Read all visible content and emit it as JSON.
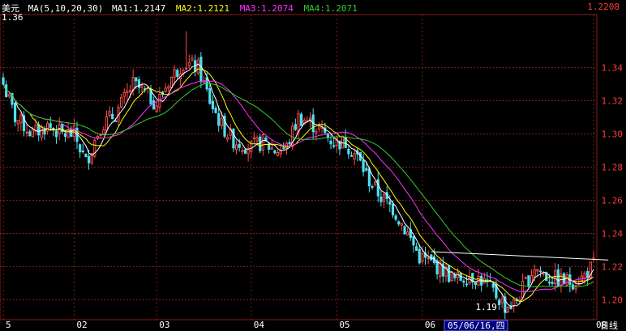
{
  "header": {
    "symbol": "美元",
    "ma_label": "MA(5,10,20,30)",
    "ma1": "MA1:1.2147",
    "ma2": "MA2:1.2121",
    "ma3": "MA3:1.2074",
    "ma4": "MA4:1.2071",
    "last_price": "1.2208",
    "high_label": "1.36",
    "low_label": "1.19",
    "cursor_label": "05/06/16,四",
    "period_label": "日线"
  },
  "colors": {
    "background": "#000000",
    "grid": "#8b1a1a",
    "up_candle": "#ff4a4a",
    "down_candle": "#4fe0f0",
    "ma1": "#ffffff",
    "ma2": "#ffff00",
    "ma3": "#ff33ff",
    "ma4": "#33cc33",
    "trendline": "#ffffff",
    "axis_text": "#ff3b3b"
  },
  "chart_data": {
    "type": "candlestick",
    "ylim": [
      1.188,
      1.372
    ],
    "y_ticks": [
      1.2,
      1.22,
      1.24,
      1.26,
      1.28,
      1.3,
      1.32,
      1.34
    ],
    "y_tick_labels": [
      "1.20",
      "1.22",
      "1.24",
      "1.26",
      "1.28",
      "1.30",
      "1.32",
      "1.34"
    ],
    "x_ticks": [
      {
        "label": "5",
        "index": 0
      },
      {
        "label": "02",
        "index": 24
      },
      {
        "label": "03",
        "index": 52
      },
      {
        "label": "04",
        "index": 84
      },
      {
        "label": "05",
        "index": 113
      },
      {
        "label": "06",
        "index": 142
      },
      {
        "label": "08",
        "index": 200
      }
    ],
    "anchors": [
      [
        0,
        1.33
      ],
      [
        4,
        1.31
      ],
      [
        10,
        1.3
      ],
      [
        15,
        1.305
      ],
      [
        20,
        1.3
      ],
      [
        24,
        1.3
      ],
      [
        28,
        1.283
      ],
      [
        33,
        1.305
      ],
      [
        38,
        1.312
      ],
      [
        44,
        1.33
      ],
      [
        48,
        1.325
      ],
      [
        52,
        1.318
      ],
      [
        56,
        1.332
      ],
      [
        61,
        1.343
      ],
      [
        66,
        1.34
      ],
      [
        70,
        1.32
      ],
      [
        74,
        1.305
      ],
      [
        78,
        1.296
      ],
      [
        84,
        1.292
      ],
      [
        88,
        1.295
      ],
      [
        92,
        1.29
      ],
      [
        96,
        1.292
      ],
      [
        100,
        1.31
      ],
      [
        103,
        1.308
      ],
      [
        107,
        1.303
      ],
      [
        112,
        1.295
      ],
      [
        116,
        1.295
      ],
      [
        120,
        1.286
      ],
      [
        124,
        1.272
      ],
      [
        128,
        1.262
      ],
      [
        132,
        1.255
      ],
      [
        137,
        1.24
      ],
      [
        141,
        1.226
      ],
      [
        145,
        1.222
      ],
      [
        149,
        1.218
      ],
      [
        153,
        1.212
      ],
      [
        158,
        1.215
      ],
      [
        162,
        1.212
      ],
      [
        166,
        1.205
      ],
      [
        170,
        1.196
      ],
      [
        173,
        1.197
      ],
      [
        177,
        1.21
      ],
      [
        180,
        1.22
      ],
      [
        184,
        1.214
      ],
      [
        188,
        1.212
      ],
      [
        192,
        1.211
      ],
      [
        196,
        1.213
      ],
      [
        200,
        1.221
      ]
    ],
    "candle_count": 201,
    "trendline": {
      "from": [
        145,
        1.229
      ],
      "to": [
        205,
        1.224
      ]
    },
    "high": {
      "index": 62,
      "value": 1.362
    },
    "low": {
      "index": 171,
      "value": 1.192
    }
  }
}
